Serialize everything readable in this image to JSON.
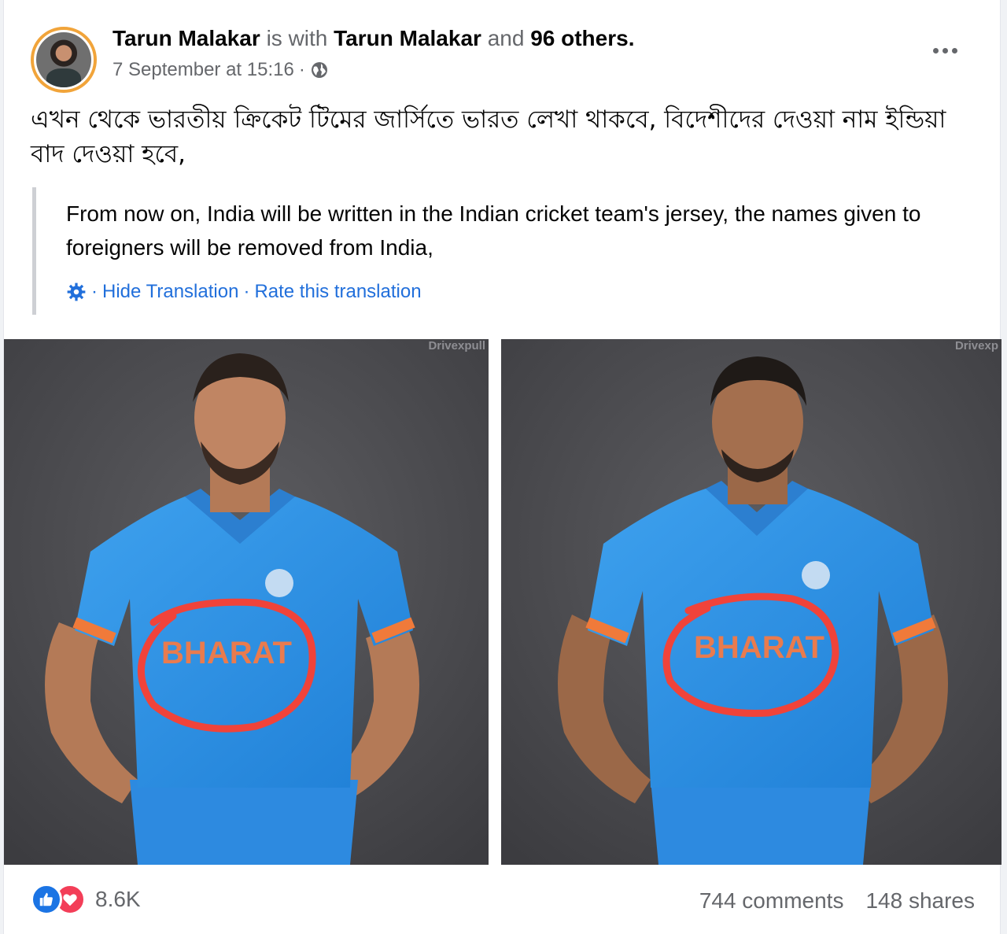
{
  "author": {
    "name": "Tarun Malakar",
    "with_label": "is with",
    "tagged_name": "Tarun Malakar",
    "and_label": "and",
    "others": "96 others.",
    "timestamp": "7 September at 15:16",
    "separator": "·"
  },
  "post_text": "এখন থেকে ভারতীয় ক্রিকেট টিমের জার্সিতে ভারত লেখা থাকবে, বিদেশীদের দেওয়া নাম ইন্ডিয়া বাদ দেওয়া হবে,",
  "translation": {
    "text": "From now on, India will be written in the Indian cricket team's jersey, the names given to foreigners will be removed from India,",
    "separator": "·",
    "hide_label": "Hide Translation",
    "rate_label": "Rate this translation"
  },
  "photos": [
    {
      "jersey_text": "BHARAT",
      "watermark": "Drivexpull"
    },
    {
      "jersey_text": "BHARAT",
      "watermark": "Drivexp"
    }
  ],
  "reactions": {
    "count": "8.6K",
    "icons": [
      "like-icon",
      "love-icon"
    ]
  },
  "stats": {
    "comments": "744 comments",
    "shares": "148 shares"
  },
  "colors": {
    "link": "#216fdb",
    "muted": "#65676b",
    "like": "#1b74e4",
    "love": "#f33e58",
    "jersey": "#2b8fe0",
    "circle": "#f0433a"
  }
}
